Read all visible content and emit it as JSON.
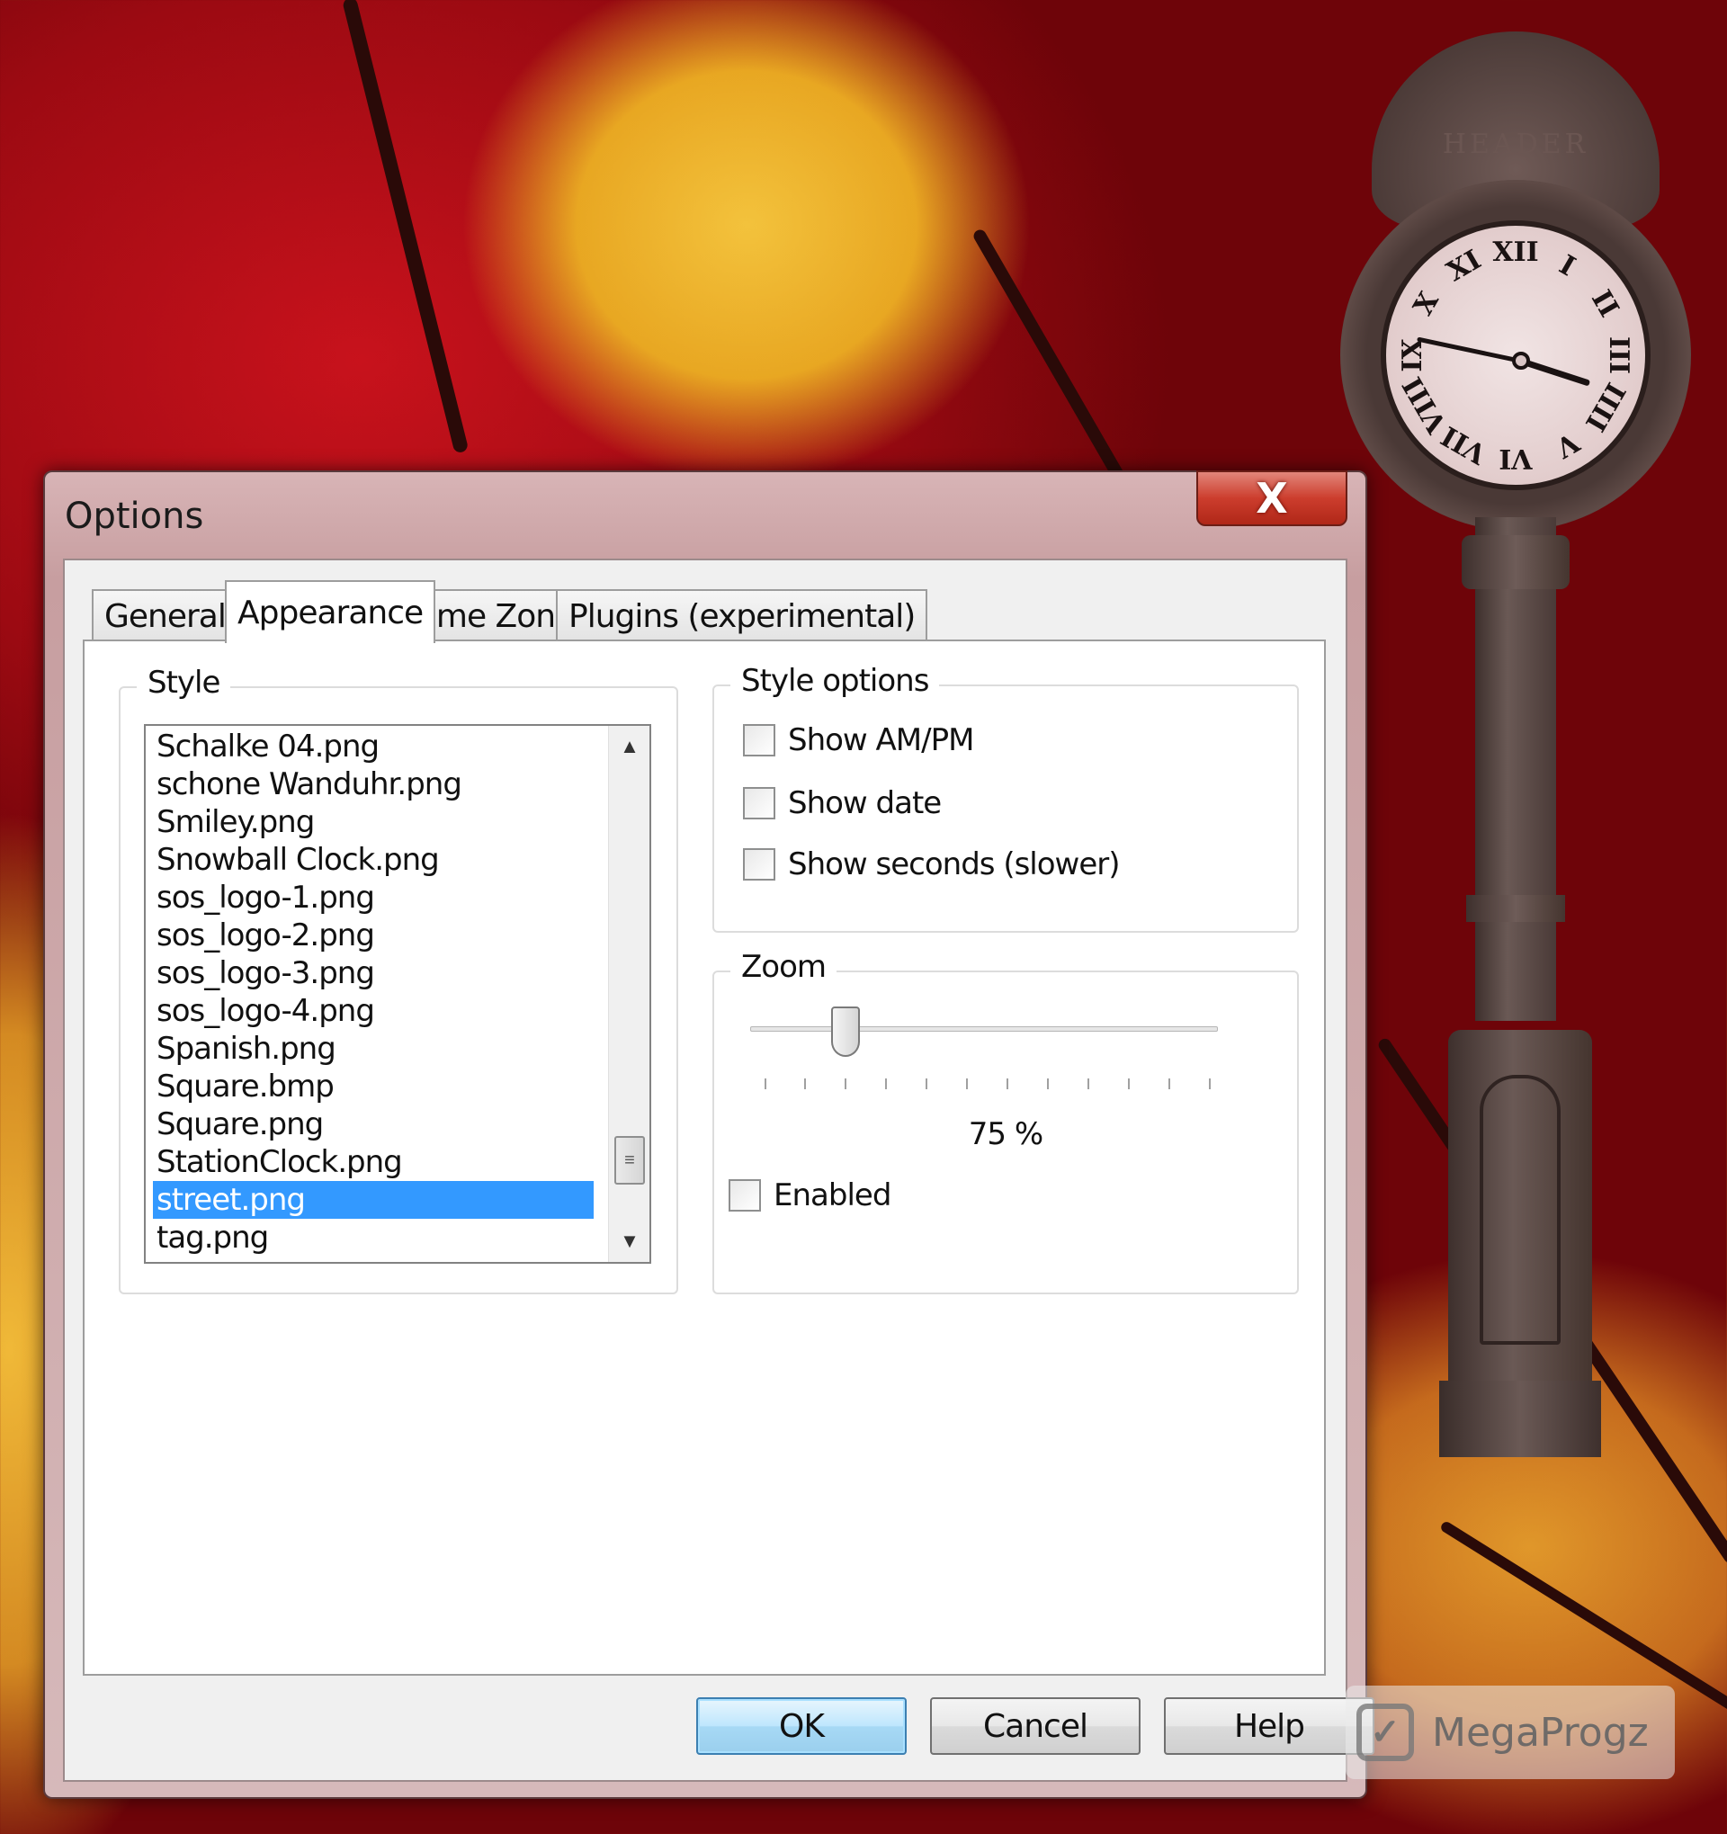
{
  "dialog": {
    "title": "Options",
    "close_glyph": "X",
    "tabs": [
      {
        "label": "General"
      },
      {
        "label": "Appearance"
      },
      {
        "label": "Time Zones"
      },
      {
        "label": "Plugins (experimental)"
      }
    ],
    "active_tab": "Appearance",
    "style_group": {
      "label": "Style",
      "items": [
        "Schalke 04.png",
        "schone Wanduhr.png",
        "Smiley.png",
        "Snowball Clock.png",
        "sos_logo-1.png",
        "sos_logo-2.png",
        "sos_logo-3.png",
        "sos_logo-4.png",
        "Spanish.png",
        "Square.bmp",
        "Square.png",
        "StationClock.png",
        "street.png",
        "tag.png"
      ],
      "selected": "street.png"
    },
    "style_options": {
      "label": "Style options",
      "show_ampm": {
        "label": "Show AM/PM",
        "checked": false
      },
      "show_date": {
        "label": "Show date",
        "checked": false
      },
      "show_seconds": {
        "label": "Show seconds (slower)",
        "checked": false
      }
    },
    "zoom": {
      "label": "Zoom",
      "value_text": "75 %",
      "value_percent": 75,
      "enabled": {
        "label": "Enabled",
        "checked": false
      }
    },
    "buttons": {
      "ok": "OK",
      "cancel": "Cancel",
      "help": "Help"
    }
  },
  "clock_gadget": {
    "crown_text": "HEADER",
    "numerals": [
      "XII",
      "I",
      "II",
      "III",
      "IIII",
      "V",
      "VI",
      "VII",
      "VIII",
      "IX",
      "X",
      "XI"
    ]
  },
  "watermark": {
    "text": "MegaProgz"
  },
  "colors": {
    "selection": "#3399ff",
    "close_button": "#cc3d2d",
    "default_button": "#bee6fd"
  }
}
